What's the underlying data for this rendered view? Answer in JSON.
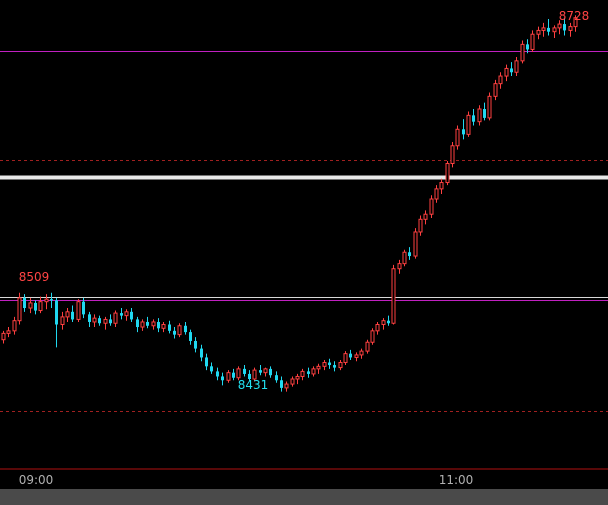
{
  "chart_data": {
    "type": "candlestick",
    "session_times": [
      "09:00",
      "11:00"
    ],
    "high": {
      "label": "8728",
      "value": 8728
    },
    "low": {
      "label": "8431",
      "value": 8431
    },
    "early_high": {
      "label": "8509",
      "value": 8509
    },
    "price_range": [
      8370,
      8740
    ],
    "reference_levels": [
      {
        "kind": "magenta-line",
        "value": 8700
      },
      {
        "kind": "magenta-line",
        "value": 8503
      },
      {
        "kind": "white-line",
        "value": 8506
      },
      {
        "kind": "white-thick-line",
        "value": 8600
      },
      {
        "kind": "dashed-line",
        "value": 8614
      },
      {
        "kind": "dashed-line",
        "value": 8416
      }
    ],
    "candles": [
      [
        8472,
        8479,
        8469,
        8477
      ],
      [
        8477,
        8482,
        8474,
        8479
      ],
      [
        8479,
        8490,
        8476,
        8487
      ],
      [
        8487,
        8509,
        8484,
        8505
      ],
      [
        8505,
        8508,
        8494,
        8497
      ],
      [
        8497,
        8505,
        8493,
        8501
      ],
      [
        8501,
        8503,
        8492,
        8495
      ],
      [
        8495,
        8506,
        8493,
        8502
      ],
      [
        8502,
        8508,
        8496,
        8504
      ],
      [
        8504,
        8509,
        8497,
        8503
      ],
      [
        8503,
        8505,
        8466,
        8484
      ],
      [
        8484,
        8494,
        8480,
        8490
      ],
      [
        8490,
        8497,
        8486,
        8494
      ],
      [
        8494,
        8499,
        8486,
        8488
      ],
      [
        8488,
        8504,
        8486,
        8502
      ],
      [
        8502,
        8505,
        8489,
        8492
      ],
      [
        8492,
        8494,
        8482,
        8486
      ],
      [
        8486,
        8492,
        8482,
        8489
      ],
      [
        8489,
        8491,
        8483,
        8485
      ],
      [
        8485,
        8490,
        8480,
        8488
      ],
      [
        8488,
        8492,
        8483,
        8485
      ],
      [
        8485,
        8495,
        8482,
        8493
      ],
      [
        8493,
        8497,
        8488,
        8491
      ],
      [
        8491,
        8496,
        8487,
        8494
      ],
      [
        8494,
        8497,
        8486,
        8488
      ],
      [
        8488,
        8490,
        8478,
        8482
      ],
      [
        8482,
        8488,
        8479,
        8486
      ],
      [
        8486,
        8490,
        8481,
        8483
      ],
      [
        8483,
        8488,
        8480,
        8486
      ],
      [
        8486,
        8489,
        8478,
        8481
      ],
      [
        8481,
        8486,
        8478,
        8484
      ],
      [
        8484,
        8487,
        8477,
        8479
      ],
      [
        8479,
        8482,
        8473,
        8476
      ],
      [
        8476,
        8485,
        8474,
        8483
      ],
      [
        8483,
        8486,
        8476,
        8478
      ],
      [
        8478,
        8480,
        8468,
        8471
      ],
      [
        8471,
        8474,
        8462,
        8465
      ],
      [
        8465,
        8468,
        8455,
        8458
      ],
      [
        8458,
        8461,
        8448,
        8451
      ],
      [
        8451,
        8454,
        8445,
        8447
      ],
      [
        8447,
        8450,
        8440,
        8443
      ],
      [
        8443,
        8446,
        8436,
        8440
      ],
      [
        8440,
        8448,
        8438,
        8446
      ],
      [
        8446,
        8449,
        8440,
        8442
      ],
      [
        8442,
        8451,
        8440,
        8449
      ],
      [
        8449,
        8452,
        8443,
        8445
      ],
      [
        8445,
        8448,
        8439,
        8441
      ],
      [
        8441,
        8450,
        8439,
        8448
      ],
      [
        8448,
        8452,
        8444,
        8446
      ],
      [
        8446,
        8450,
        8443,
        8449
      ],
      [
        8449,
        8451,
        8442,
        8444
      ],
      [
        8444,
        8447,
        8438,
        8440
      ],
      [
        8440,
        8443,
        8431,
        8434
      ],
      [
        8434,
        8439,
        8431,
        8437
      ],
      [
        8437,
        8443,
        8435,
        8441
      ],
      [
        8441,
        8445,
        8437,
        8443
      ],
      [
        8443,
        8449,
        8440,
        8447
      ],
      [
        8447,
        8450,
        8442,
        8445
      ],
      [
        8445,
        8451,
        8443,
        8449
      ],
      [
        8449,
        8453,
        8445,
        8451
      ],
      [
        8451,
        8456,
        8448,
        8454
      ],
      [
        8454,
        8457,
        8449,
        8452
      ],
      [
        8452,
        8455,
        8447,
        8450
      ],
      [
        8450,
        8456,
        8448,
        8454
      ],
      [
        8454,
        8463,
        8452,
        8461
      ],
      [
        8461,
        8464,
        8456,
        8458
      ],
      [
        8458,
        8462,
        8455,
        8460
      ],
      [
        8460,
        8465,
        8457,
        8463
      ],
      [
        8463,
        8472,
        8461,
        8470
      ],
      [
        8470,
        8481,
        8468,
        8479
      ],
      [
        8479,
        8486,
        8476,
        8484
      ],
      [
        8484,
        8489,
        8480,
        8487
      ],
      [
        8487,
        8491,
        8483,
        8485
      ],
      [
        8485,
        8531,
        8484,
        8528
      ],
      [
        8528,
        8535,
        8524,
        8532
      ],
      [
        8532,
        8543,
        8530,
        8541
      ],
      [
        8541,
        8545,
        8535,
        8538
      ],
      [
        8538,
        8560,
        8536,
        8557
      ],
      [
        8557,
        8570,
        8554,
        8567
      ],
      [
        8567,
        8574,
        8563,
        8571
      ],
      [
        8571,
        8586,
        8568,
        8583
      ],
      [
        8583,
        8594,
        8580,
        8591
      ],
      [
        8591,
        8599,
        8587,
        8596
      ],
      [
        8596,
        8613,
        8594,
        8611
      ],
      [
        8611,
        8628,
        8608,
        8625
      ],
      [
        8625,
        8641,
        8622,
        8638
      ],
      [
        8638,
        8646,
        8630,
        8634
      ],
      [
        8634,
        8652,
        8632,
        8649
      ],
      [
        8649,
        8654,
        8641,
        8644
      ],
      [
        8644,
        8657,
        8641,
        8654
      ],
      [
        8654,
        8659,
        8645,
        8647
      ],
      [
        8647,
        8667,
        8645,
        8664
      ],
      [
        8664,
        8677,
        8661,
        8674
      ],
      [
        8674,
        8683,
        8670,
        8680
      ],
      [
        8680,
        8689,
        8676,
        8686
      ],
      [
        8686,
        8691,
        8680,
        8683
      ],
      [
        8683,
        8695,
        8680,
        8692
      ],
      [
        8692,
        8708,
        8690,
        8705
      ],
      [
        8705,
        8709,
        8698,
        8701
      ],
      [
        8701,
        8716,
        8699,
        8713
      ],
      [
        8713,
        8719,
        8709,
        8716
      ],
      [
        8716,
        8722,
        8711,
        8718
      ],
      [
        8718,
        8725,
        8712,
        8715
      ],
      [
        8715,
        8720,
        8710,
        8718
      ],
      [
        8718,
        8724,
        8713,
        8721
      ],
      [
        8721,
        8726,
        8712,
        8716
      ],
      [
        8716,
        8722,
        8711,
        8719
      ],
      [
        8719,
        8728,
        8715,
        8726
      ]
    ]
  }
}
